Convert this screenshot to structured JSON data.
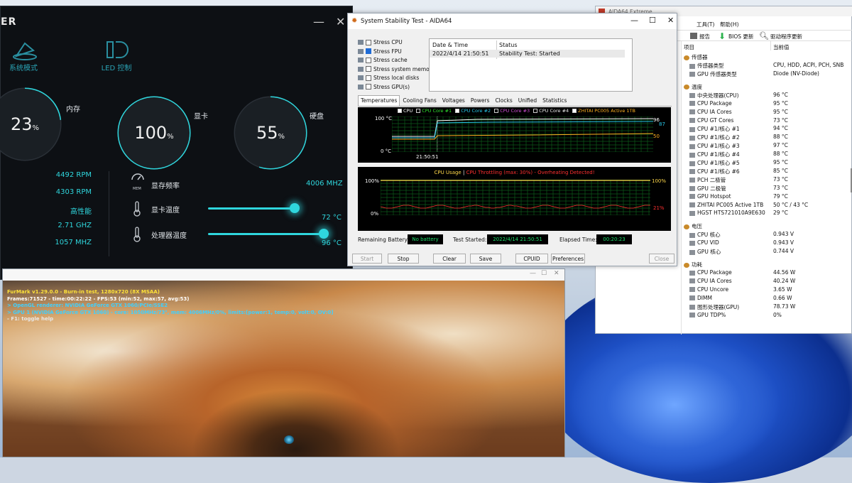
{
  "armoury": {
    "logo": "ER",
    "modes": [
      "系统模式",
      "LED 控制"
    ],
    "gauges": [
      {
        "label": "内存",
        "value": "23",
        "unit": "%",
        "fraction": 0.23
      },
      {
        "label": "显卡",
        "value": "100",
        "unit": "%",
        "fraction": 1.0
      },
      {
        "label": "硬盘",
        "value": "55",
        "unit": "%",
        "fraction": 0.55
      }
    ],
    "left_values": [
      "4492 RPM",
      "4303 RPM",
      "高性能",
      "2.71 GHZ",
      "1057 MHZ"
    ],
    "mem_icon_text": "MEM",
    "rows": [
      {
        "label": "显存频率",
        "value": "4006 MHZ"
      },
      {
        "label": "显卡温度",
        "value": "72 °C",
        "fraction": 0.72
      },
      {
        "label": "处理器温度",
        "value": "96 °C",
        "fraction": 0.96
      }
    ],
    "window_buttons": [
      "—",
      "✕"
    ]
  },
  "stability": {
    "title": "System Stability Test - AIDA64",
    "window_buttons": [
      "—",
      "☐",
      "✕"
    ],
    "stress": [
      {
        "label": "Stress CPU",
        "checked": false
      },
      {
        "label": "Stress FPU",
        "checked": true
      },
      {
        "label": "Stress cache",
        "checked": false
      },
      {
        "label": "Stress system memory",
        "checked": false
      },
      {
        "label": "Stress local disks",
        "checked": false
      },
      {
        "label": "Stress GPU(s)",
        "checked": false
      }
    ],
    "log_headers": [
      "Date & Time",
      "Status"
    ],
    "log_rows": [
      [
        "2022/4/14 21:50:51",
        "Stability Test: Started"
      ]
    ],
    "tabs": [
      "Temperatures",
      "Cooling Fans",
      "Voltages",
      "Powers",
      "Clocks",
      "Unified",
      "Statistics"
    ],
    "temp_legend": [
      {
        "label": "CPU",
        "color": "#ffffff",
        "checked": true
      },
      {
        "label": "CPU Core #1",
        "color": "#2ee02e",
        "checked": false
      },
      {
        "label": "CPU Core #2",
        "color": "#27c6e8",
        "checked": true
      },
      {
        "label": "CPU Core #3",
        "color": "#d04fd6",
        "checked": false
      },
      {
        "label": "CPU Core #4",
        "color": "#e8e8e8",
        "checked": false
      },
      {
        "label": "ZHITAI PC005 Active 1TB",
        "color": "#ffb020",
        "checked": true
      }
    ],
    "temp_chart": {
      "ymax": "100 °C",
      "ymin": "0 °C",
      "time": "21:50:51",
      "right_values": [
        "96",
        "87",
        "50"
      ]
    },
    "usage_chart": {
      "title_a": "CPU Usage",
      "sep": "|",
      "title_b": "CPU Throttling (max: 30%) - Overheating Detected!",
      "left_top": "100%",
      "left_bottom": "0%",
      "right_top": "100%",
      "right_bottom": "21%"
    },
    "battery_label": "Remaining Battery:",
    "battery_value": "No battery",
    "started_label": "Test Started:",
    "started_value": "2022/4/14 21:50:51",
    "elapsed_label": "Elapsed Time:",
    "elapsed_value": "00:20:23",
    "buttons": [
      "Start",
      "Stop",
      "Clear",
      "Save",
      "CPUID",
      "Preferences",
      "Close"
    ]
  },
  "sensors": {
    "title": "AIDA64 Extreme",
    "menu_item": "工具(T)",
    "menu_help": "帮助(H)",
    "toolbar": [
      "报告",
      "BIOS 更新",
      "驱动程序更新"
    ],
    "col_headers": [
      "项目",
      "当前值"
    ],
    "groups": [
      {
        "name": "传感器",
        "rows": [
          [
            "传感器类型",
            "CPU, HDD, ACPI, PCH, SNB"
          ],
          [
            "GPU 传感器类型",
            "Diode (NV-Diode)"
          ]
        ]
      },
      {
        "name": "温度",
        "rows": [
          [
            "中央处理器(CPU)",
            "96 °C"
          ],
          [
            "CPU Package",
            "95 °C"
          ],
          [
            "CPU IA Cores",
            "95 °C"
          ],
          [
            "CPU GT Cores",
            "73 °C"
          ],
          [
            "CPU #1/核心 #1",
            "94 °C"
          ],
          [
            "CPU #1/核心 #2",
            "88 °C"
          ],
          [
            "CPU #1/核心 #3",
            "97 °C"
          ],
          [
            "CPU #1/核心 #4",
            "88 °C"
          ],
          [
            "CPU #1/核心 #5",
            "95 °C"
          ],
          [
            "CPU #1/核心 #6",
            "85 °C"
          ],
          [
            "PCH 二极管",
            "73 °C"
          ],
          [
            "GPU 二极管",
            "73 °C"
          ],
          [
            "GPU Hotspot",
            "79 °C"
          ],
          [
            "ZHITAI PC005 Active 1TB",
            "50 °C / 43 °C"
          ],
          [
            "HGST HTS721010A9E630",
            "29 °C"
          ]
        ]
      },
      {
        "name": "电压",
        "rows": [
          [
            "CPU 核心",
            "0.943 V"
          ],
          [
            "CPU VID",
            "0.943 V"
          ],
          [
            "GPU 核心",
            "0.744 V"
          ]
        ]
      },
      {
        "name": "功耗",
        "rows": [
          [
            "CPU Package",
            "44.56 W"
          ],
          [
            "CPU IA Cores",
            "40.24 W"
          ],
          [
            "CPU Uncore",
            "3.65 W"
          ],
          [
            "DIMM",
            "0.66 W"
          ],
          [
            "图形处理器(GPU)",
            "78.73 W"
          ],
          [
            "GPU TDP%",
            "0%"
          ]
        ]
      }
    ]
  },
  "furmark": {
    "window_buttons": [
      "—",
      "☐",
      "✕"
    ],
    "lines": [
      {
        "text": "FurMark v1.29.0.0 - Burn-in test, 1280x720 (8X MSAA)",
        "color": "#ffe23a"
      },
      {
        "text": "Frames:71527 - time:00:22:22 - FPS:53 (min:52, max:57, avg:53)",
        "color": "#ffffff"
      },
      {
        "text": "> OpenGL renderer: NVIDIA GeForce GTX 1060/PCIe/SSE2",
        "color": "#3fd0ff"
      },
      {
        "text": "> GPU 1 (NVIDIA GeForce GTX 1060) - core: 1050MHz/73°, mem: 4006MHz/0%, limits:[power:1, temp:0, volt:0, OV:0]",
        "color": "#3fd0ff"
      },
      {
        "text": "- F1: toggle help",
        "color": "#e8e8e8"
      }
    ]
  }
}
